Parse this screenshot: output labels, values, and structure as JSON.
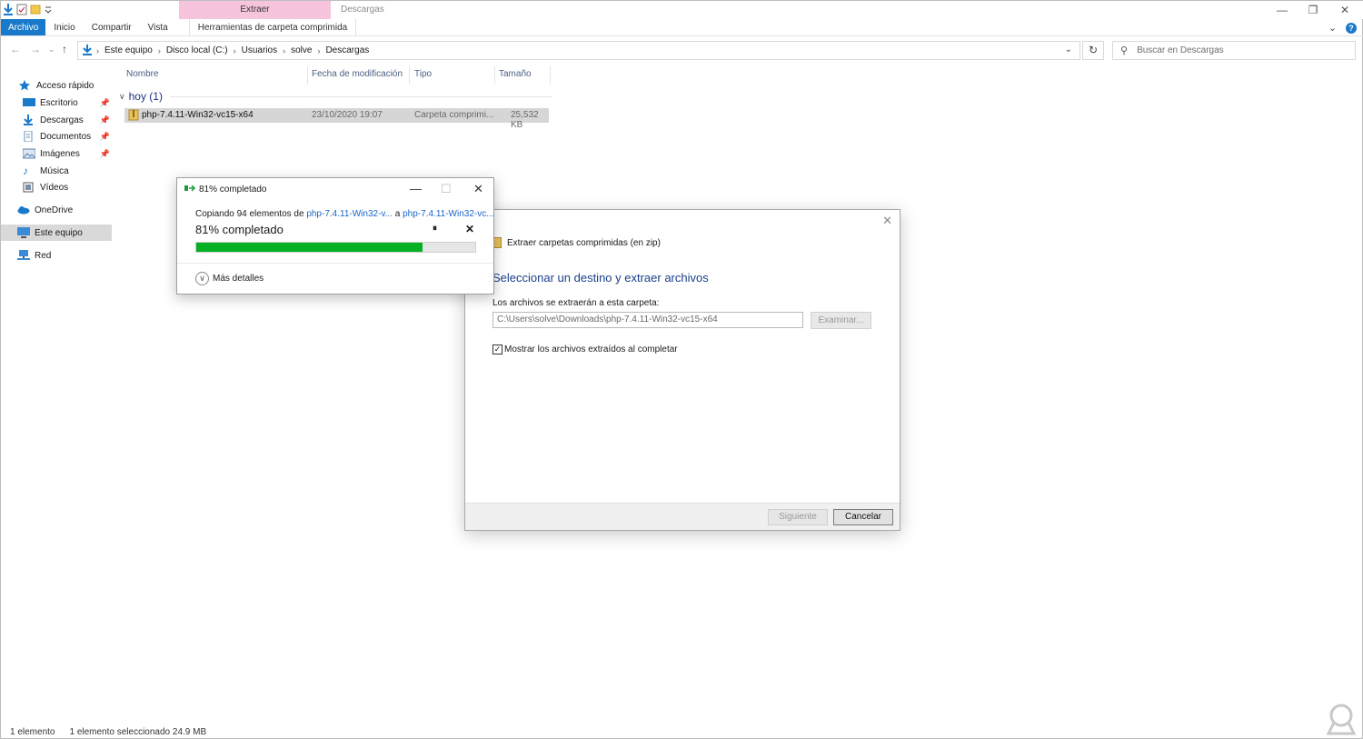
{
  "window": {
    "title": "Descargas",
    "context_group": "Extraer",
    "controls": {
      "minimize": "—",
      "restore": "❐",
      "close": "✕"
    }
  },
  "ribbon": {
    "tabs": [
      "Archivo",
      "Inicio",
      "Compartir",
      "Vista"
    ],
    "context_tab": "Herramientas de carpeta comprimida",
    "expand_icon": "⌄",
    "help": "?"
  },
  "nav": {
    "back": "←",
    "forward": "→",
    "dropdown": "⌄",
    "up": "↑",
    "breadcrumbs": [
      "Este equipo",
      "Disco local (C:)",
      "Usuarios",
      "solve",
      "Descargas"
    ],
    "search_placeholder": "Buscar en Descargas"
  },
  "sidebar": {
    "items": [
      {
        "label": "Acceso rápido",
        "icon": "star-icon"
      },
      {
        "label": "Escritorio",
        "icon": "desktop-icon",
        "pinned": true
      },
      {
        "label": "Descargas",
        "icon": "download-icon",
        "pinned": true
      },
      {
        "label": "Documentos",
        "icon": "document-icon",
        "pinned": true
      },
      {
        "label": "Imágenes",
        "icon": "image-icon",
        "pinned": true
      },
      {
        "label": "Música",
        "icon": "music-icon"
      },
      {
        "label": "Vídeos",
        "icon": "video-icon"
      },
      {
        "label": "OneDrive",
        "icon": "cloud-icon"
      },
      {
        "label": "Este equipo",
        "icon": "computer-icon",
        "selected": true
      },
      {
        "label": "Red",
        "icon": "network-icon"
      }
    ]
  },
  "filelist": {
    "columns": [
      "Nombre",
      "Fecha de modificación",
      "Tipo",
      "Tamaño"
    ],
    "group": "hoy (1)",
    "rows": [
      {
        "name": "php-7.4.11-Win32-vc15-x64",
        "date": "23/10/2020 19:07",
        "type": "Carpeta comprimi...",
        "size": "25,532 KB"
      }
    ]
  },
  "statusbar": {
    "count": "1 elemento",
    "selected": "1 elemento seleccionado  24.9 MB"
  },
  "progress_dialog": {
    "title": "81% completado",
    "copying_prefix": "Copiando 94 elementos de",
    "source": "php-7.4.11-Win32-v...",
    "to": "a",
    "dest": "php-7.4.11-Win32-vc...",
    "percent_text": "81% completado",
    "percent": 81,
    "pause": "⏸",
    "cancel": "✕",
    "more_details": "Más detalles",
    "accent": "#06b025"
  },
  "extract_wizard": {
    "window_title": "Extraer carpetas comprimidas (en zip)",
    "heading": "Seleccionar un destino y extraer archivos",
    "dest_label": "Los archivos se extraerán a esta carpeta:",
    "dest_path": "C:\\Users\\solve\\Downloads\\php-7.4.11-Win32-vc15-x64",
    "browse": "Examinar...",
    "checkbox_label": "Mostrar los archivos extraídos al completar",
    "checkbox_checked": true,
    "next": "Siguiente",
    "cancel": "Cancelar",
    "close": "✕"
  },
  "colors": {
    "accent": "#1979ca",
    "context_tab": "#f6c5dd",
    "link": "#1a65c8",
    "heading": "#1a3f8c"
  }
}
